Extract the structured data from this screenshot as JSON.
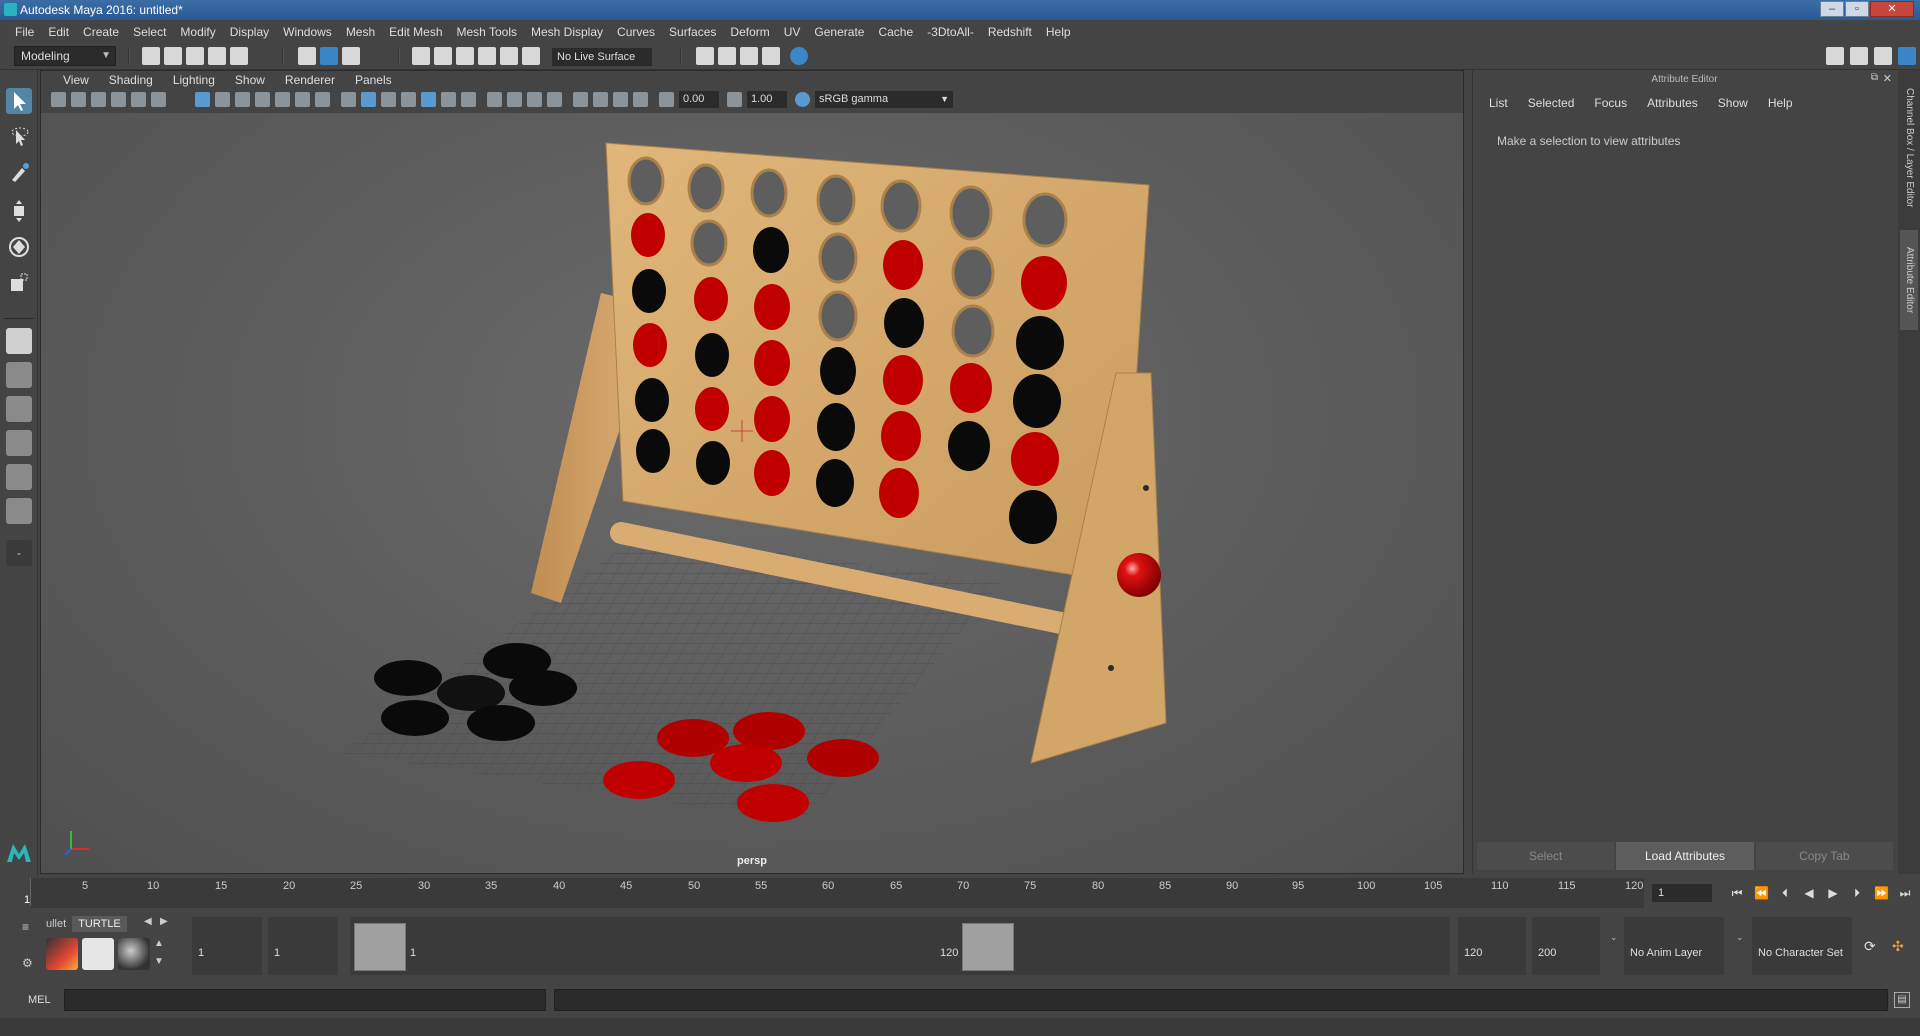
{
  "window": {
    "title": "Autodesk Maya 2016: untitled*"
  },
  "menubar": [
    "File",
    "Edit",
    "Create",
    "Select",
    "Modify",
    "Display",
    "Windows",
    "Mesh",
    "Edit Mesh",
    "Mesh Tools",
    "Mesh Display",
    "Curves",
    "Surfaces",
    "Deform",
    "UV",
    "Generate",
    "Cache",
    "-3DtoAll-",
    "Redshift",
    "Help"
  ],
  "statusline": {
    "mode": "Modeling",
    "live_surface": "No Live Surface"
  },
  "viewport": {
    "panel_menus": [
      "View",
      "Shading",
      "Lighting",
      "Show",
      "Renderer",
      "Panels"
    ],
    "exposure": "0.00",
    "gamma": "1.00",
    "color_space": "sRGB gamma",
    "camera": "persp"
  },
  "attribute_editor": {
    "title": "Attribute Editor",
    "menus": [
      "List",
      "Selected",
      "Focus",
      "Attributes",
      "Show",
      "Help"
    ],
    "message": "Make a selection to view attributes",
    "footer": {
      "select": "Select",
      "load": "Load Attributes",
      "copy_tab": "Copy Tab"
    }
  },
  "side_tabs": {
    "channel_box": "Channel Box / Layer Editor",
    "attribute_editor": "Attribute Editor"
  },
  "timeline": {
    "ticks": [
      "5",
      "10",
      "15",
      "20",
      "25",
      "30",
      "35",
      "40",
      "45",
      "50",
      "55",
      "60",
      "65",
      "70",
      "75",
      "80",
      "85",
      "90",
      "95",
      "100",
      "105",
      "110",
      "115",
      "120"
    ],
    "current_frame_label": "1",
    "current_frame": "1"
  },
  "shelf": {
    "tabs": [
      "ullet",
      "TURTLE"
    ]
  },
  "range": {
    "start": "1",
    "anim_start": "1",
    "range_start_label": "1",
    "range_end_label": "120",
    "end": "120",
    "anim_end": "200",
    "anim_layer": "No Anim Layer",
    "character_set": "No Character Set"
  },
  "cmdline": {
    "label": "MEL"
  },
  "colors": {
    "accent": "#5285a6",
    "red_disc": "#c00000",
    "black_disc": "#0a0a0a",
    "wood": "#d4a86a"
  }
}
